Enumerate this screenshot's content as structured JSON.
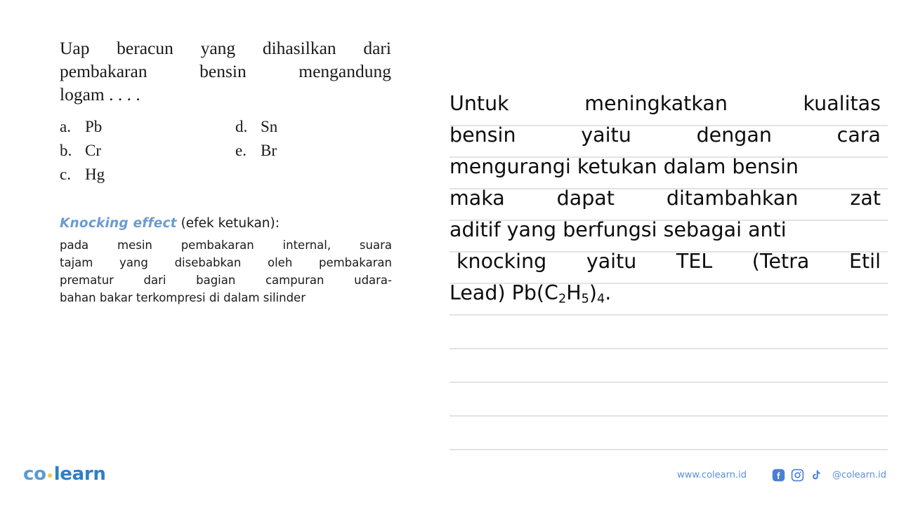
{
  "question": {
    "stem_lines": [
      "Uap beracun yang dihasilkan dari",
      "pembakaran bensin mengandung",
      "logam . . . ."
    ],
    "options": [
      {
        "letter": "a.",
        "text": "Pb"
      },
      {
        "letter": "b.",
        "text": "Cr"
      },
      {
        "letter": "c.",
        "text": "Hg"
      },
      {
        "letter": "d.",
        "text": "Sn"
      },
      {
        "letter": "e.",
        "text": "Br"
      }
    ]
  },
  "explanation": {
    "term": "Knocking effect",
    "gloss": " (efek ketukan):",
    "body_lines": [
      "pada mesin pembakaran internal, suara",
      "tajam yang disebabkan oleh pembakaran",
      "prematur dari bagian campuran udara-",
      "bahan bakar terkompresi di dalam silinder"
    ]
  },
  "answer": {
    "lines": [
      "Untuk meningkatkan kualitas",
      "bensin yaitu dengan cara",
      "mengurangi ketukan dalam bensin",
      "maka dapat ditambahkan zat",
      "aditif yang berfungsi sebagai anti",
      "knocking yaitu TEL (Tetra Etil"
    ],
    "formula_line": {
      "prefix": "Lead) Pb(C",
      "sub1": "2",
      "mid": "H",
      "sub2": "5",
      "suffix": ")",
      "sub3": "4",
      "period": "."
    },
    "rule_count": 11
  },
  "footer": {
    "logo": {
      "co": "co",
      "learn": "learn"
    },
    "site_url": "www.colearn.id",
    "handle": "@colearn.id",
    "social": [
      {
        "name": "facebook-icon"
      },
      {
        "name": "instagram-icon"
      },
      {
        "name": "tiktok-icon"
      }
    ]
  },
  "colors": {
    "accent_blue": "#6b9bd2",
    "brand_blue": "#2f7fc4",
    "brand_light_blue": "#5b9bd5",
    "brand_dot": "#f2c744",
    "rule_gray": "#e3e3e3",
    "text_dark": "#1a1a1a"
  }
}
